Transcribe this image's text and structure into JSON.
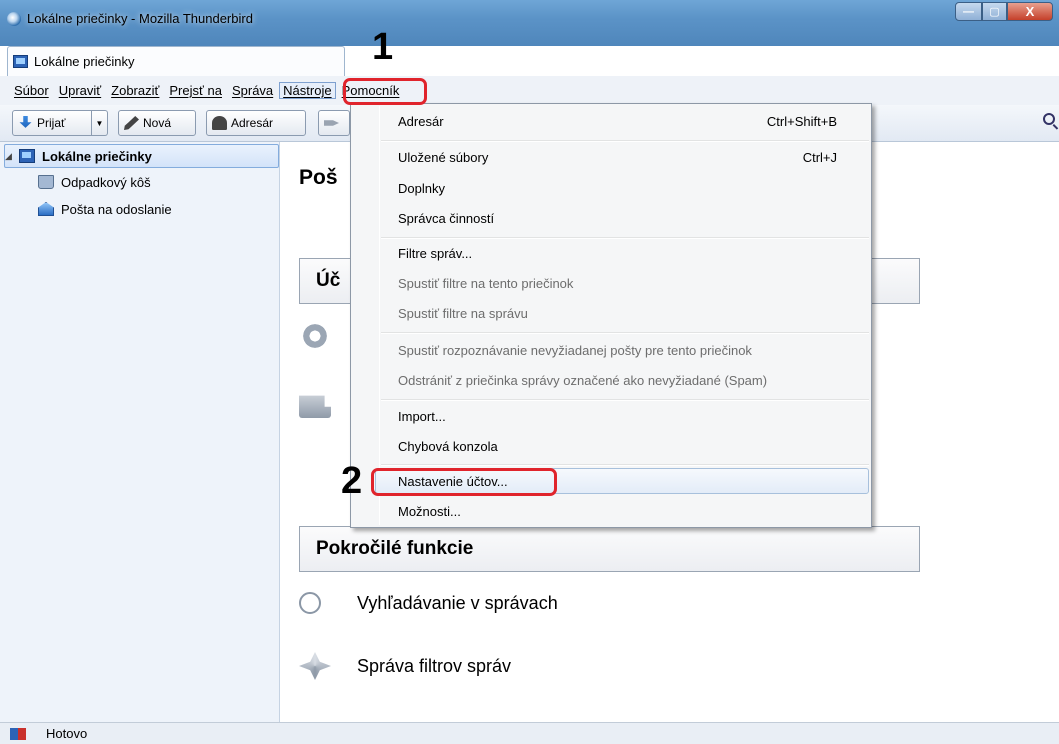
{
  "window": {
    "title": "Lokálne priečinky - Mozilla Thunderbird",
    "controls": {
      "minimize": "—",
      "maximize": "▢",
      "close": "X"
    }
  },
  "tab": {
    "label": "Lokálne priečinky",
    "icon": "local-folders-icon"
  },
  "menubar": [
    "Súbor",
    "Upraviť",
    "Zobraziť",
    "Prejsť na",
    "Správa",
    "Nástroje",
    "Pomocník"
  ],
  "toolbar": {
    "receive": "Prijať",
    "new": "Nová",
    "addressbook": "Adresár"
  },
  "folders": [
    {
      "label": "Lokálne priečinky",
      "icon": "local-folders-icon"
    },
    {
      "label": "Odpadkový kôš",
      "icon": "trash-icon"
    },
    {
      "label": "Pošta na odoslanie",
      "icon": "outbox-icon"
    }
  ],
  "main": {
    "heading": "Poš",
    "accounts_section": "Úč",
    "advanced_section": "Pokročilé funkcie",
    "search_messages": "Vyhľadávanie v správach",
    "manage_filters": "Správa filtrov správ"
  },
  "tools_menu": {
    "addressbook": "Adresár",
    "addressbook_shortcut": "Ctrl+Shift+B",
    "saved_files": "Uložené súbory",
    "saved_files_shortcut": "Ctrl+J",
    "addons": "Doplnky",
    "activity_manager": "Správca činností",
    "message_filters": "Filtre správ...",
    "run_filters_folder": "Spustiť filtre na tento priečinok",
    "run_filters_message": "Spustiť filtre na správu",
    "junk_detection": "Spustiť rozpoznávanie nevyžiadanej pošty pre tento priečinok",
    "delete_junk": "Odstrániť z priečinka správy označené ako nevyžiadané (Spam)",
    "import": "Import...",
    "error_console": "Chybová konzola",
    "account_settings": "Nastavenie účtov...",
    "options": "Možnosti..."
  },
  "annotations": {
    "step1": "1",
    "step2": "2"
  },
  "status": {
    "text": "Hotovo"
  },
  "colors": {
    "highlight": "#e0242c",
    "menu_hover": "#e3ecf8"
  }
}
